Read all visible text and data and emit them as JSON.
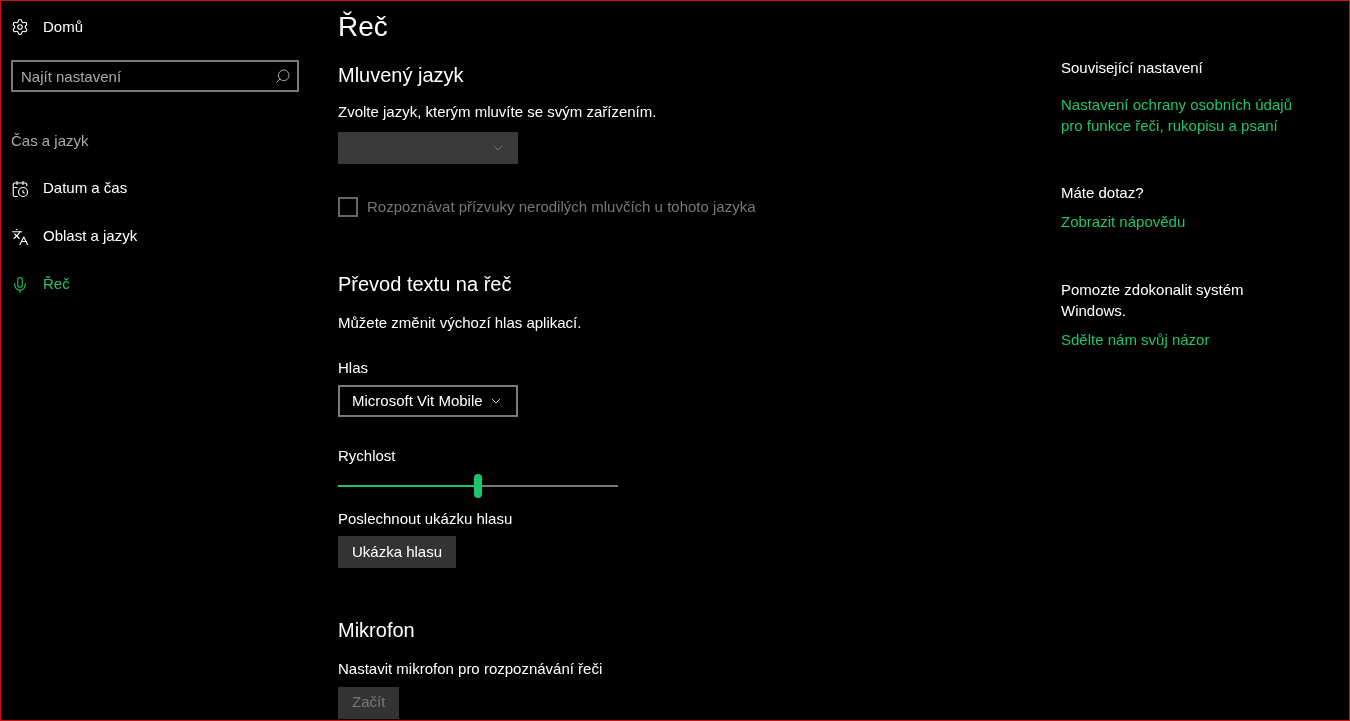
{
  "sidebar": {
    "home": {
      "label": "Domů",
      "kind": "gear"
    },
    "search": {
      "placeholder": "Najít nastavení"
    },
    "section": "Čas a jazyk",
    "items": [
      {
        "label": "Datum a čas",
        "kind": "calendar",
        "selected": false
      },
      {
        "label": "Oblast a jazyk",
        "kind": "language",
        "selected": false
      },
      {
        "label": "Řeč",
        "kind": "mic",
        "selected": true
      }
    ]
  },
  "main": {
    "title": "Řeč",
    "spoken_language": {
      "heading": "Mluvený jazyk",
      "description": "Zvolte jazyk, kterým mluvíte se svým zařízením.",
      "dropdown": {
        "disabled": true
      },
      "checkbox": {
        "label": "Rozpoznávat přízvuky nerodilých mluvčích u tohoto jazyka",
        "checked": false,
        "disabled": true
      }
    },
    "text_to_speech": {
      "heading": "Převod textu na řeč",
      "description": "Můžete změnit výchozí hlas aplikací.",
      "voice_label": "Hlas",
      "voice": {
        "value": "Microsoft Vit Mobile",
        "disabled": false
      },
      "speed_label": "Rychlost",
      "speed": {
        "level": 0.5
      },
      "preview_label": "Poslechnout ukázku hlasu",
      "preview_button": {
        "label": "Ukázka hlasu",
        "disabled": false
      }
    },
    "microphone": {
      "heading": "Mikrofon",
      "description": "Nastavit mikrofon pro rozpoznávání řeči",
      "button": {
        "label": "Začít",
        "disabled": true
      }
    }
  },
  "related": {
    "heading": "Související nastavení",
    "links": [
      "Nastavení ochrany osobních údajů pro funkce řeči, rukopisu a psaní"
    ],
    "question": "Máte dotaz?",
    "help_link": "Zobrazit nápovědu",
    "improve": "Pomozte zdokonalit systém Windows.",
    "feedback_link": "Sdělte nám svůj názor"
  }
}
